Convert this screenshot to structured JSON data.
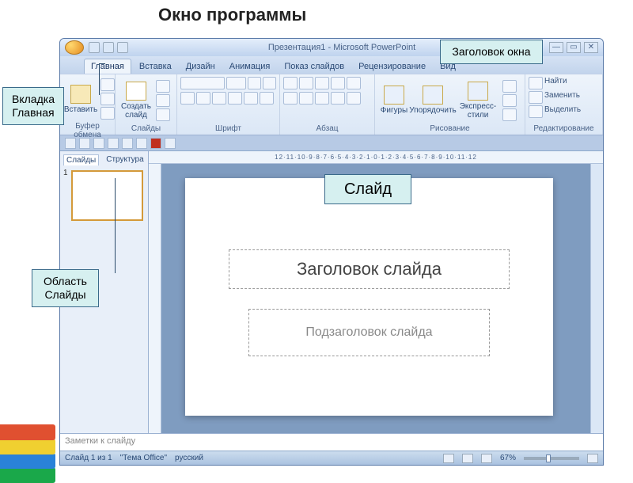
{
  "edu": {
    "page_title": "Окно программы",
    "callout_title": "Заголовок окна",
    "callout_tab": "Вкладка Главная",
    "callout_panel": "Область Слайды",
    "callout_slide": "Слайд"
  },
  "titlebar": {
    "title": "Презентация1 - Microsoft PowerPoint",
    "min": "—",
    "max": "▭",
    "close": "✕"
  },
  "tabs": {
    "home": "Главная",
    "insert": "Вставка",
    "design": "Дизайн",
    "animation": "Анимация",
    "slideshow": "Показ слайдов",
    "review": "Рецензирование",
    "view": "Вид"
  },
  "ribbon": {
    "clipboard": {
      "paste": "Вставить",
      "label": "Буфер обмена"
    },
    "slides": {
      "new_slide": "Создать слайд",
      "label": "Слайды"
    },
    "font": {
      "label": "Шрифт"
    },
    "paragraph": {
      "label": "Абзац"
    },
    "drawing": {
      "shapes": "Фигуры",
      "arrange": "Упорядочить",
      "styles": "Экспресс-стили",
      "label": "Рисование"
    },
    "editing": {
      "find": "Найти",
      "replace": "Заменить",
      "select": "Выделить",
      "label": "Редактирование"
    }
  },
  "panel": {
    "tab_slides": "Слайды",
    "tab_outline": "Структура",
    "thumb_num": "1"
  },
  "ruler_h": "12·11·10·9·8·7·6·5·4·3·2·1·0·1·2·3·4·5·6·7·8·9·10·11·12",
  "slide": {
    "title_placeholder": "Заголовок слайда",
    "subtitle_placeholder": "Подзаголовок слайда"
  },
  "notes": {
    "placeholder": "Заметки к слайду"
  },
  "status": {
    "slide_of": "Слайд 1 из 1",
    "theme": "\"Тема Office\"",
    "lang": "русский",
    "zoom": "67%"
  }
}
